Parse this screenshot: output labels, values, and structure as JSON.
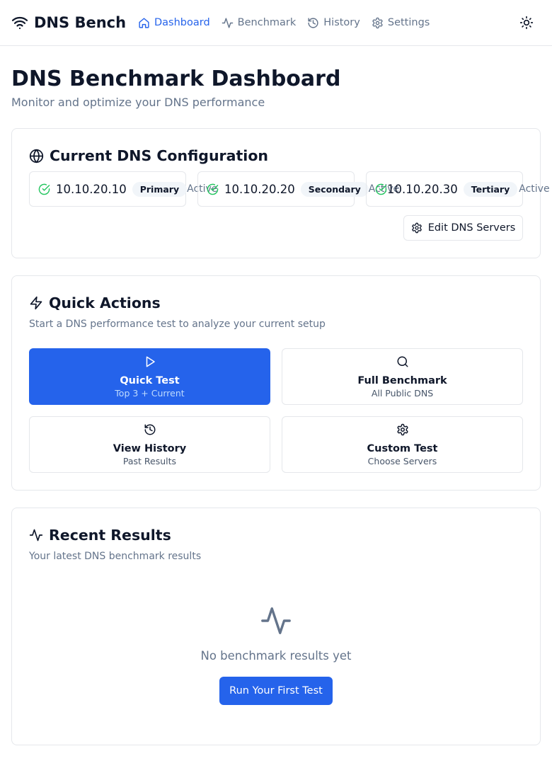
{
  "brand": {
    "name": "DNS Bench",
    "icon": "wifi-icon"
  },
  "nav": [
    {
      "label": "Dashboard",
      "icon": "home-icon",
      "active": true
    },
    {
      "label": "Benchmark",
      "icon": "activity-icon",
      "active": false
    },
    {
      "label": "History",
      "icon": "history-icon",
      "active": false
    },
    {
      "label": "Settings",
      "icon": "gear-icon",
      "active": false
    }
  ],
  "theme_toggle": {
    "icon": "sun-icon"
  },
  "page": {
    "title": "DNS Benchmark Dashboard",
    "subtitle": "Monitor and optimize your DNS performance"
  },
  "dns_config": {
    "title": "Current DNS Configuration",
    "icon": "globe-icon",
    "servers": [
      {
        "ip": "10.10.20.10",
        "role": "Primary",
        "status": "Active"
      },
      {
        "ip": "10.10.20.20",
        "role": "Secondary",
        "status": "Active"
      },
      {
        "ip": "10.10.20.30",
        "role": "Tertiary",
        "status": "Active"
      }
    ],
    "edit_label": "Edit DNS Servers"
  },
  "quick_actions": {
    "title": "Quick Actions",
    "icon": "zap-icon",
    "description": "Start a DNS performance test to analyze your current setup",
    "actions": [
      {
        "title": "Quick Test",
        "subtitle": "Top 3 + Current",
        "icon": "play-icon",
        "primary": true
      },
      {
        "title": "Full Benchmark",
        "subtitle": "All Public DNS",
        "icon": "search-icon",
        "primary": false
      },
      {
        "title": "View History",
        "subtitle": "Past Results",
        "icon": "history-icon",
        "primary": false
      },
      {
        "title": "Custom Test",
        "subtitle": "Choose Servers",
        "icon": "gear-icon",
        "primary": false
      }
    ]
  },
  "recent_results": {
    "title": "Recent Results",
    "icon": "activity-icon",
    "description": "Your latest DNS benchmark results",
    "empty_text": "No benchmark results yet",
    "run_label": "Run Your First Test"
  },
  "colors": {
    "accent": "#2563eb",
    "success": "#22c55e",
    "muted": "#64748b",
    "border": "#e5e7eb"
  }
}
